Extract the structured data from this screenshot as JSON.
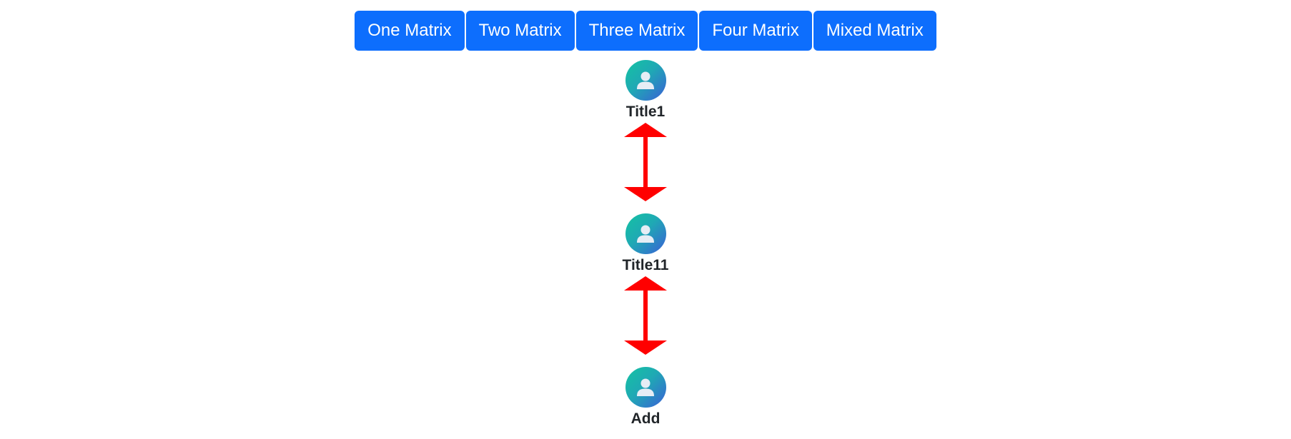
{
  "toolbar": {
    "buttons": [
      {
        "label": "One Matrix"
      },
      {
        "label": "Two Matrix"
      },
      {
        "label": "Three Matrix"
      },
      {
        "label": "Four Matrix"
      },
      {
        "label": "Mixed Matrix"
      }
    ]
  },
  "tree": {
    "nodes": [
      {
        "title": "Title1",
        "icon": "user-avatar-icon"
      },
      {
        "title": "Title11",
        "icon": "user-avatar-icon"
      },
      {
        "title": "Add",
        "icon": "user-avatar-icon"
      }
    ],
    "connector": {
      "icon": "double-headed-arrow-icon",
      "color": "#ff0000"
    }
  },
  "colors": {
    "button_bg": "#0d6efd",
    "button_text": "#ffffff",
    "avatar_gradient_start": "#14c3a2",
    "avatar_gradient_end": "#3a5fd6",
    "arrow": "#ff0000",
    "title_text": "#212529"
  }
}
